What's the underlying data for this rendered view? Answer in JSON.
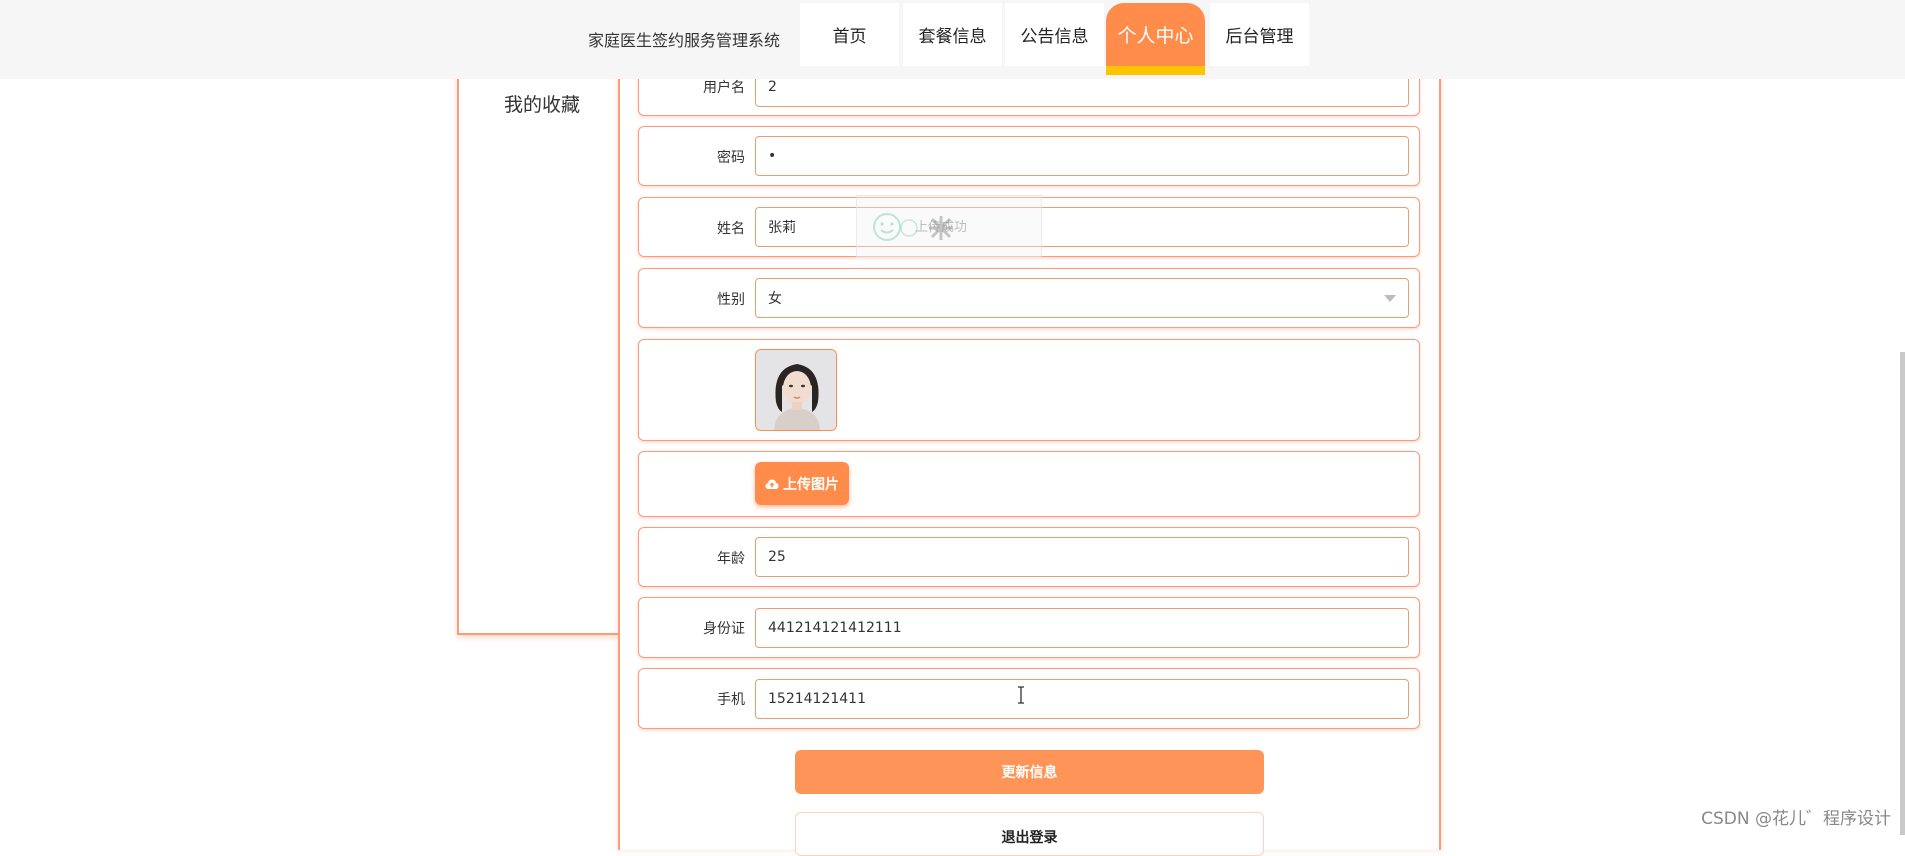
{
  "header": {
    "site_title": "家庭医生签约服务管理系统",
    "nav": [
      {
        "label": "首页"
      },
      {
        "label": "套餐信息"
      },
      {
        "label": "公告信息"
      },
      {
        "label": "个人中心",
        "active": true
      },
      {
        "label": "后台管理"
      }
    ]
  },
  "sidebar": {
    "items": [
      {
        "label": "我的收藏"
      }
    ]
  },
  "form": {
    "username": {
      "label": "用户名",
      "value": "2"
    },
    "password": {
      "label": "密码",
      "value": "•"
    },
    "name": {
      "label": "姓名",
      "value": "张莉"
    },
    "gender": {
      "label": "性别",
      "value": "女"
    },
    "upload_label": "上传图片",
    "age": {
      "label": "年龄",
      "value": "25"
    },
    "id_card": {
      "label": "身份证",
      "value": "441214121412111"
    },
    "phone": {
      "label": "手机",
      "value": "15214121411"
    },
    "update_label": "更新信息",
    "logout_label": "退出登录"
  },
  "floater": {
    "text": "上传成功"
  },
  "watermark": "CSDN @花儿゛程序设计",
  "colors": {
    "accent": "#ff8c4a",
    "highlight": "#ffc400",
    "border": "#ff9b7a"
  }
}
